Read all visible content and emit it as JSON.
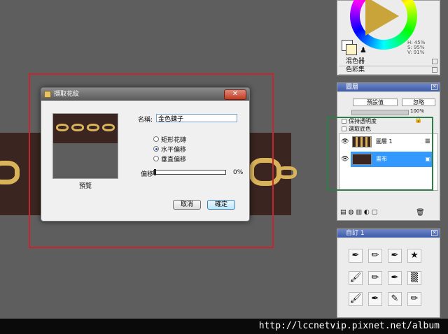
{
  "dialog": {
    "title": "擷取花紋",
    "close_label": "✕",
    "preview_label": "預覽",
    "name_label": "名稱:",
    "name_value": "金色鍊子",
    "options": [
      "矩形花磚",
      "水平偏移",
      "垂直偏移"
    ],
    "selected_option": 1,
    "offset_label": "偏移",
    "offset_value": "0%",
    "offset_fraction": 0,
    "cancel_label": "取消",
    "ok_label": "確定"
  },
  "color_panel": {
    "hsv": [
      "H: 45%",
      "S: 95%",
      "V: 91%"
    ],
    "rows": [
      "混色器",
      "色彩集"
    ]
  },
  "layers_panel": {
    "title": "圖層",
    "blend_mode": "預設值",
    "composite": "忽略",
    "opacity": "100%",
    "preserve_transparency": "保持透明度",
    "pick_underlying": "選取底色",
    "layers": [
      {
        "name": "圖層 1",
        "selected": false
      },
      {
        "name": "畫布",
        "selected": true
      }
    ]
  },
  "custom_panel": {
    "title": "自訂 1",
    "tools": [
      "✒",
      "✏",
      "✒",
      "★",
      "🖌",
      "✏",
      "✒",
      "▒",
      "🖌",
      "✒",
      "✎",
      "✏"
    ]
  },
  "watermark": "http://lccnetvip.pixnet.net/album",
  "colors": {
    "accent": "#3d5aa8",
    "selected_layer": "#3399ff",
    "chain_gold": "#d9b35a",
    "strip_brown": "#3a2520",
    "red_frame": "#c8262e",
    "green_frame": "#2e7d46"
  }
}
